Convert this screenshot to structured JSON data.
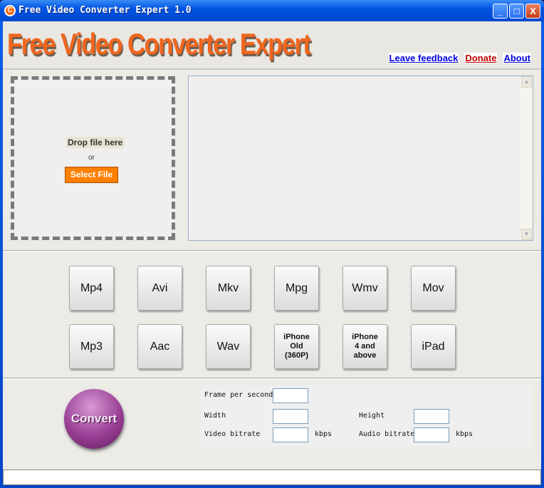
{
  "window": {
    "title": "Free Video Converter Expert 1.0",
    "minimize": "_",
    "maximize": "□",
    "close": "X"
  },
  "header": {
    "logo": "Free Video Converter Expert",
    "links": {
      "feedback": "Leave feedback",
      "donate": "Donate",
      "about": "About"
    }
  },
  "drop": {
    "text": "Drop file here",
    "or": "or",
    "select": "Select File"
  },
  "scroll": {
    "up": "▲",
    "down": "▼"
  },
  "formats": [
    "Mp4",
    "Avi",
    "Mkv",
    "Mpg",
    "Wmv",
    "Mov",
    "Mp3",
    "Aac",
    "Wav",
    "iPhone Old (360P)",
    "iPhone 4 and above",
    "iPad"
  ],
  "convert": "Convert",
  "settings": {
    "fps": "Frame per second",
    "width": "Width",
    "height": "Height",
    "video_bitrate": "Video bitrate",
    "audio_bitrate": "Audio bitrate",
    "kbps": "kbps"
  },
  "colors": {
    "accent": "#f0661e",
    "convert": "#9a3f96"
  }
}
